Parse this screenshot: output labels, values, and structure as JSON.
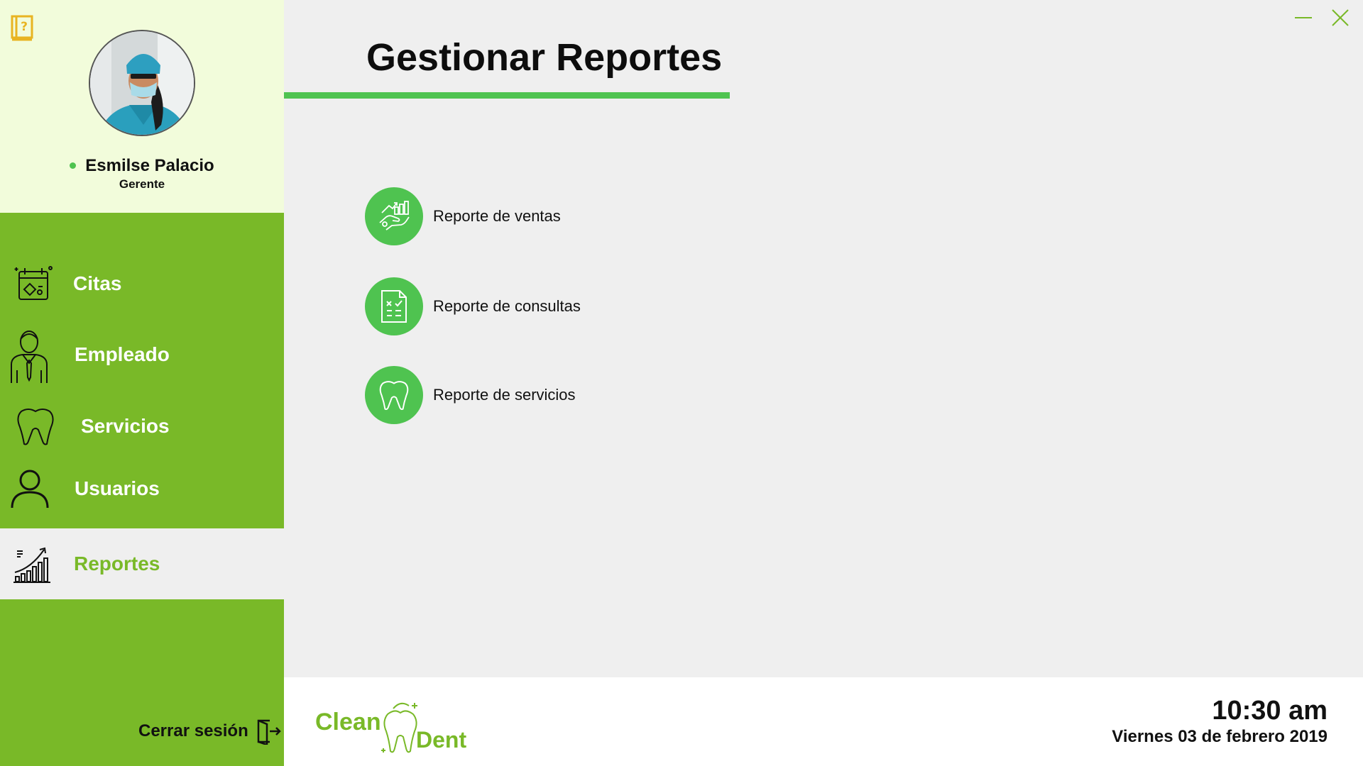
{
  "app": {
    "brand_color": "#79b928",
    "accent_green": "#4fc350"
  },
  "profile": {
    "name": "Esmilse Palacio",
    "role": "Gerente",
    "status": "online"
  },
  "nav": {
    "items": [
      {
        "label": "Citas",
        "icon": "calendar-icon"
      },
      {
        "label": "Empleado",
        "icon": "employee-icon"
      },
      {
        "label": "Servicios",
        "icon": "tooth-icon"
      },
      {
        "label": "Usuarios",
        "icon": "user-icon"
      },
      {
        "label": "Reportes",
        "icon": "growth-chart-icon",
        "active": true
      }
    ],
    "logout_label": "Cerrar sesión"
  },
  "main": {
    "title": "Gestionar Reportes",
    "reports": [
      {
        "label": "Reporte de ventas",
        "icon": "sales-hand-icon"
      },
      {
        "label": "Reporte de consultas",
        "icon": "checklist-document-icon"
      },
      {
        "label": "Reporte de servicios",
        "icon": "tooth-icon"
      }
    ]
  },
  "footer": {
    "logo_part1": "Clean",
    "logo_part2": "Dent",
    "time": "10:30 am",
    "date": "Viernes 03 de febrero 2019"
  }
}
